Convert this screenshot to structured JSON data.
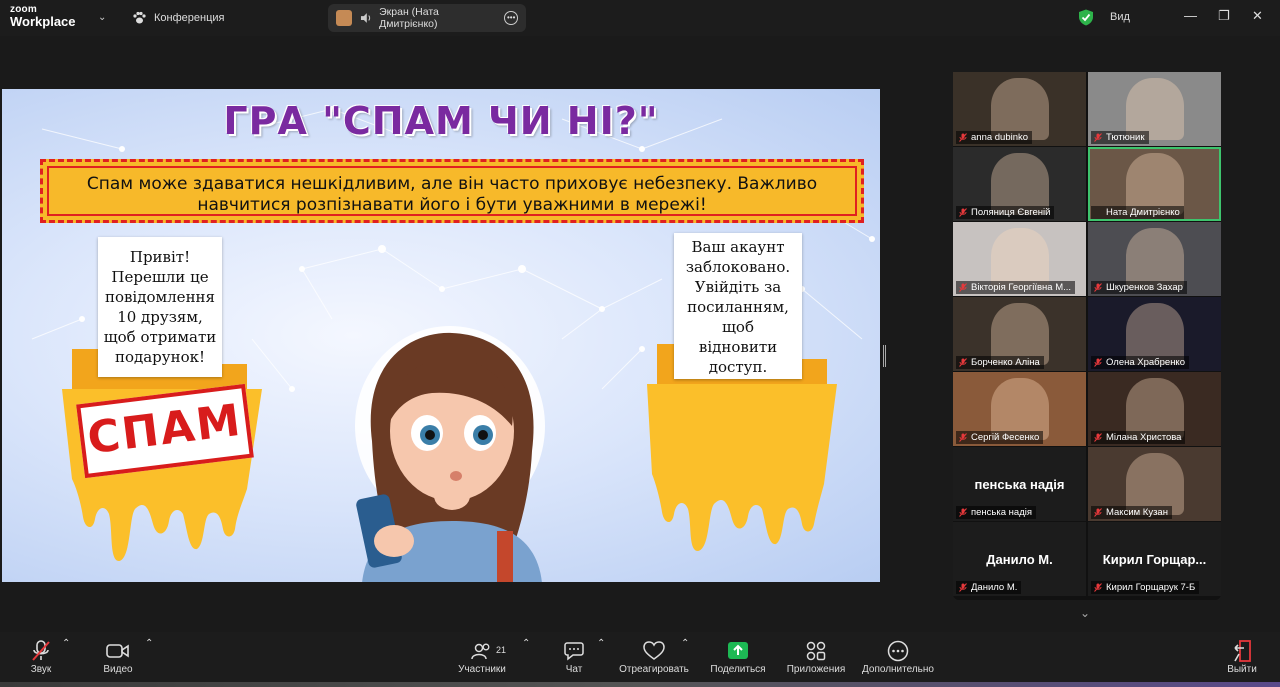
{
  "app": {
    "logo_line1": "zoom",
    "logo_line2": "Workplace",
    "meeting_label": "Конференция",
    "share_pill_label": "Экран (Ната Дмитрієнко)",
    "view_label": "Вид"
  },
  "slide": {
    "title": "ГРА \"СПАМ ЧИ НІ?\"",
    "banner_line1": "Спам може здаватися нешкідливим, але він часто приховує небезпеку. Важливо",
    "banner_line2": "навчитися розпізнавати його і бути уважними в мережі!",
    "left_note": [
      "Привіт!",
      "Перешли це",
      "повідомлення",
      "10 друзям,",
      "щоб отримати",
      "подарунок!"
    ],
    "right_note": [
      "Ваш акаунт",
      "заблоковано.",
      "Увійдіть за",
      "посиланням,",
      "щоб",
      "відновити",
      "доступ."
    ],
    "stamp_text": "СПАМ"
  },
  "participants": [
    {
      "name": "anna dubinko",
      "muted": true,
      "tone": "#3a3128",
      "big": ""
    },
    {
      "name": "Тютюник",
      "muted": true,
      "tone": "#8a8a8a",
      "big": ""
    },
    {
      "name": "Поляниця Євгеній",
      "muted": true,
      "tone": "#2b2b2b",
      "big": ""
    },
    {
      "name": "Ната Дмитрієнко",
      "muted": false,
      "tone": "#6b5747",
      "big": "",
      "active": true
    },
    {
      "name": "Вікторія Георгіївна М...",
      "muted": true,
      "tone": "#c7c2c0",
      "big": ""
    },
    {
      "name": "Шкуренков Захар",
      "muted": true,
      "tone": "#4d4d52",
      "big": ""
    },
    {
      "name": "Борченко Аліна",
      "muted": true,
      "tone": "#3b322a",
      "big": ""
    },
    {
      "name": "Олена Храбренко",
      "muted": true,
      "tone": "#1a1a2a",
      "big": ""
    },
    {
      "name": "Сергій Фесенко",
      "muted": true,
      "tone": "#8a5a3a",
      "big": ""
    },
    {
      "name": "Мілана Христова",
      "muted": true,
      "tone": "#3a2a22",
      "big": ""
    },
    {
      "name": "пенська надія",
      "muted": true,
      "tone": "#1c1c1c",
      "big": "пенська надія"
    },
    {
      "name": "Максим Кузан",
      "muted": true,
      "tone": "#4a3a30",
      "big": ""
    },
    {
      "name": "Данило М.",
      "muted": true,
      "tone": "#1c1c1c",
      "big": "Данило М."
    },
    {
      "name": "Кирил Горщарук 7-Б",
      "muted": true,
      "tone": "#1c1c1c",
      "big": "Кирил  Горщар..."
    }
  ],
  "toolbar": {
    "audio": "Звук",
    "video": "Видео",
    "participants": "Участники",
    "participants_count": "21",
    "chat": "Чат",
    "react": "Отреагировать",
    "share": "Поделиться",
    "apps": "Приложения",
    "more": "Дополнительно",
    "leave": "Выйти"
  },
  "colors": {
    "accent_green": "#3ec46d",
    "share_green": "#1db954",
    "mute_red": "#e5383b",
    "banner_yellow": "#f7b92a",
    "banner_border": "#e02020",
    "title_purple": "#7a2aa0"
  }
}
